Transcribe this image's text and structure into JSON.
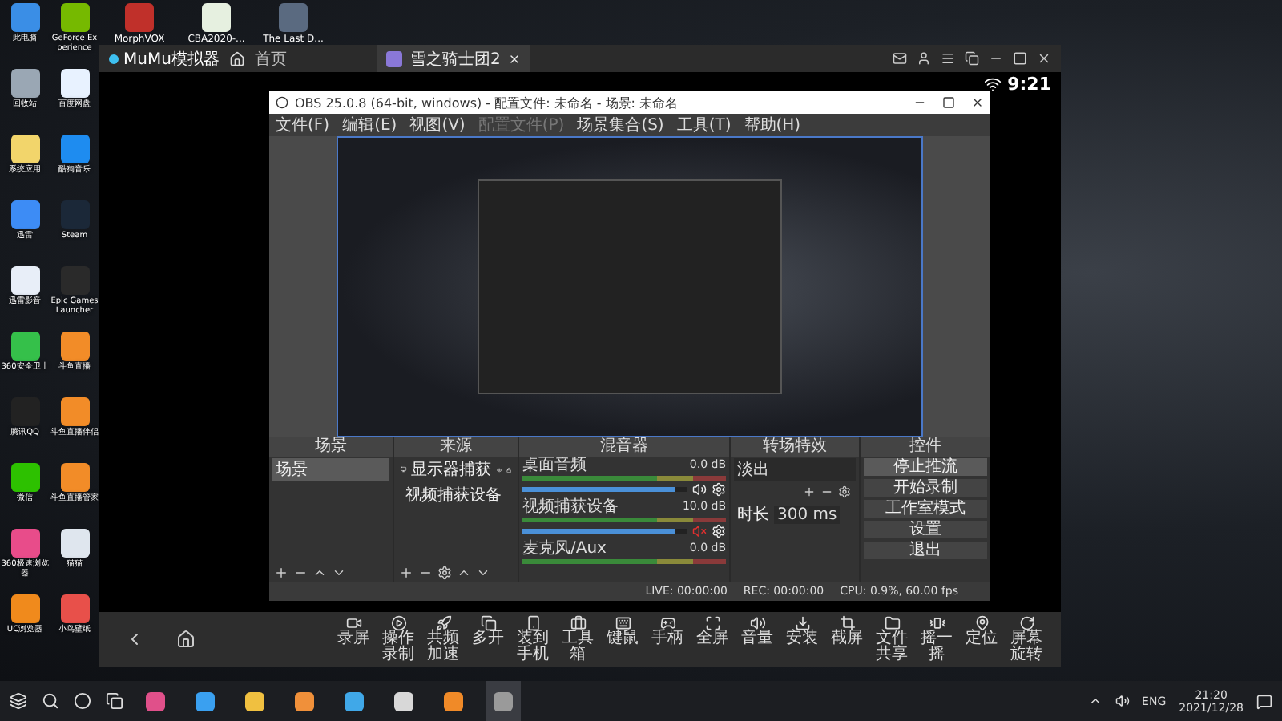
{
  "desktop_icons": [
    {
      "label": "此电脑",
      "color": "#3a8ee6"
    },
    {
      "label": "GeForce Experience",
      "color": "#76b900"
    },
    {
      "label": "回收站",
      "color": "#9aa7b4"
    },
    {
      "label": "百度网盘",
      "color": "#e8f2ff"
    },
    {
      "label": "系统应用",
      "color": "#f2d56b"
    },
    {
      "label": "酷狗音乐",
      "color": "#1e8cf0"
    },
    {
      "label": "迅雷",
      "color": "#3d8cf5"
    },
    {
      "label": "Steam",
      "color": "#1b2838"
    },
    {
      "label": "迅雷影音",
      "color": "#e8eef8"
    },
    {
      "label": "Epic Games Launcher",
      "color": "#2a2a2a"
    },
    {
      "label": "360安全卫士",
      "color": "#35c04a"
    },
    {
      "label": "斗鱼直播",
      "color": "#f28c28"
    },
    {
      "label": "腾讯QQ",
      "color": "#222222"
    },
    {
      "label": "斗鱼直播伴侣",
      "color": "#f28c28"
    },
    {
      "label": "微信",
      "color": "#2dc100"
    },
    {
      "label": "斗鱼直播管家",
      "color": "#f28c28"
    },
    {
      "label": "360极速浏览器",
      "color": "#e84c8a"
    },
    {
      "label": "猫猫",
      "color": "#dfe6ee"
    },
    {
      "label": "UC浏览器",
      "color": "#f08a1c"
    },
    {
      "label": "小鸟壁纸",
      "color": "#e8504a"
    }
  ],
  "top_icons": [
    {
      "label": "MorphVOX",
      "color": "#c0302a"
    },
    {
      "label": "CBA2020-...",
      "color": "#e6f0e0"
    },
    {
      "label": "The Last D...",
      "color": "#5a6a80"
    }
  ],
  "emulator": {
    "brand": "MuMu模拟器",
    "home": "首页",
    "tabs": [
      {
        "label": "雪之骑士团2",
        "selected": true
      }
    ],
    "clock": "9:21",
    "toolbar": [
      {
        "label": "录屏"
      },
      {
        "label": "操作录制"
      },
      {
        "label": "共频加速"
      },
      {
        "label": "多开"
      },
      {
        "label": "装到手机"
      },
      {
        "label": "工具箱"
      },
      {
        "label": "键鼠"
      },
      {
        "label": "手柄"
      },
      {
        "label": "全屏"
      },
      {
        "label": "音量"
      },
      {
        "label": "安装"
      },
      {
        "label": "截屏"
      },
      {
        "label": "文件共享"
      },
      {
        "label": "摇一摇"
      },
      {
        "label": "定位"
      },
      {
        "label": "屏幕旋转"
      }
    ]
  },
  "obs": {
    "title": "OBS 25.0.8 (64-bit, windows) - 配置文件: 未命名 - 场景: 未命名",
    "menu": [
      {
        "label": "文件(F)",
        "disabled": false
      },
      {
        "label": "编辑(E)",
        "disabled": false
      },
      {
        "label": "视图(V)",
        "disabled": false
      },
      {
        "label": "配置文件(P)",
        "disabled": true
      },
      {
        "label": "场景集合(S)",
        "disabled": false
      },
      {
        "label": "工具(T)",
        "disabled": false
      },
      {
        "label": "帮助(H)",
        "disabled": false
      }
    ],
    "scenes": {
      "header": "场景",
      "items": [
        {
          "label": "场景",
          "selected": true
        }
      ]
    },
    "sources": {
      "header": "来源",
      "items": [
        {
          "label": "显示器捕获",
          "kind": "display"
        },
        {
          "label": "视频捕获设备",
          "kind": "camera"
        }
      ]
    },
    "mixer": {
      "header": "混音器",
      "channels": [
        {
          "name": "桌面音频",
          "reading": "0.0 dB",
          "level": 0.92,
          "muted": false
        },
        {
          "name": "视频捕获设备",
          "reading": "10.0 dB",
          "level": 0.92,
          "muted": true
        },
        {
          "name": "麦克风/Aux",
          "reading": "0.0 dB"
        }
      ]
    },
    "transitions": {
      "header": "转场特效",
      "value": "淡出",
      "duration_label": "时长",
      "duration": "300 ms"
    },
    "controls": {
      "header": "控件",
      "buttons": [
        {
          "label": "停止推流",
          "active": true
        },
        {
          "label": "开始录制",
          "active": false
        },
        {
          "label": "工作室模式",
          "active": false
        },
        {
          "label": "设置",
          "active": false
        },
        {
          "label": "退出",
          "active": false
        }
      ]
    },
    "status": {
      "live": "LIVE: 00:00:00",
      "rec": "REC: 00:00:00",
      "cpu": "CPU: 0.9%, 60.00 fps"
    }
  },
  "taskbar": {
    "apps": [
      {
        "color": "#e0508a",
        "selected": false
      },
      {
        "color": "#3aa0f0",
        "selected": false
      },
      {
        "color": "#f0c040",
        "selected": false
      },
      {
        "color": "#f0903a",
        "selected": false
      },
      {
        "color": "#40a8e8",
        "selected": false
      },
      {
        "color": "#d8d8d8",
        "selected": false
      },
      {
        "color": "#f08a28",
        "selected": false
      },
      {
        "color": "#9a9a9a",
        "selected": true
      }
    ],
    "lang": "ENG",
    "time": "21:20",
    "date": "2021/12/28"
  }
}
